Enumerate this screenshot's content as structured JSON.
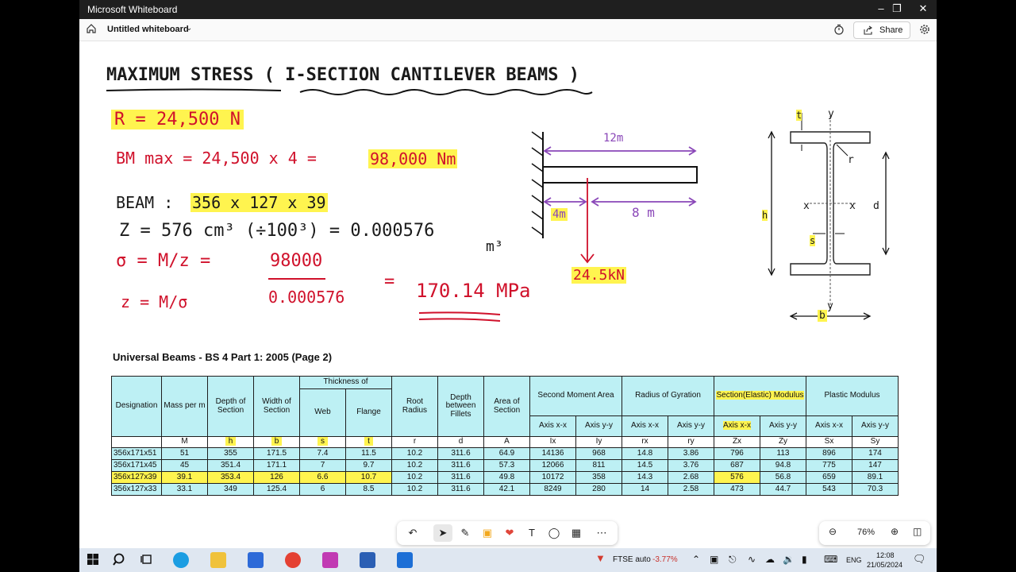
{
  "window": {
    "title": "Microsoft Whiteboard"
  },
  "header": {
    "board_title": "Untitled whiteboard",
    "share_label": "Share"
  },
  "notes": {
    "title": "MAXIMUM STRESS ( I-SECTION CANTILEVER BEAMS )",
    "r_line": "R = 24,500 N",
    "bm_line_a": "BM max = 24,500 x 4 =",
    "bm_line_b": "98,000 Nm",
    "beam_label": "BEAM :",
    "beam_value": "356 x 127 x 39",
    "z_line": "Z = 576 cm³ (÷100³) = 0.000576",
    "z_unit": "m³",
    "sigma_line": "σ = M/z =",
    "fraction_num": "98000",
    "fraction_den": "0.000576",
    "equals": "=",
    "result": "170.14 MPa",
    "z_formula": "z = M/σ"
  },
  "beam_diagram": {
    "length_total": "12m",
    "dist_a": "4m",
    "dist_b": "8 m",
    "load": "24.5kN"
  },
  "section_diagram": {
    "t": "t",
    "y_top": "y",
    "r": "r",
    "h": "h",
    "x_left": "x",
    "x_right": "x",
    "d": "d",
    "s": "s",
    "y_bottom": "y",
    "b": "b"
  },
  "table": {
    "title": "Universal Beams - BS 4 Part 1: 2005 (Page 2)",
    "headers": {
      "designation": "Designation",
      "mass": "Mass per m",
      "depth": "Depth of Section",
      "width": "Width of Section",
      "thickness": "Thickness of",
      "web": "Web",
      "flange": "Flange",
      "root": "Root Radius",
      "depth_fillets": "Depth between Fillets",
      "area": "Area of Section",
      "second_moment": "Second Moment Area",
      "gyration": "Radius of Gyration",
      "elastic": "Section(Elastic) Modulus",
      "plastic": "Plastic Modulus",
      "axis_xx": "Axis x-x",
      "axis_yy": "Axis y-y"
    },
    "symbols": [
      "",
      "M",
      "h",
      "b",
      "s",
      "t",
      "r",
      "d",
      "A",
      "Ix",
      "Iy",
      "rx",
      "ry",
      "Zx",
      "Zy",
      "Sx",
      "Sy"
    ],
    "rows": [
      [
        "356x171x51",
        "51",
        "355",
        "171.5",
        "7.4",
        "11.5",
        "10.2",
        "311.6",
        "64.9",
        "14136",
        "968",
        "14.8",
        "3.86",
        "796",
        "113",
        "896",
        "174"
      ],
      [
        "356x171x45",
        "45",
        "351.4",
        "171.1",
        "7",
        "9.7",
        "10.2",
        "311.6",
        "57.3",
        "12066",
        "811",
        "14.5",
        "3.76",
        "687",
        "94.8",
        "775",
        "147"
      ],
      [
        "356x127x39",
        "39.1",
        "353.4",
        "126",
        "6.6",
        "10.7",
        "10.2",
        "311.6",
        "49.8",
        "10172",
        "358",
        "14.3",
        "2.68",
        "576",
        "56.8",
        "659",
        "89.1"
      ],
      [
        "356x127x33",
        "33.1",
        "349",
        "125.4",
        "6",
        "8.5",
        "10.2",
        "311.6",
        "42.1",
        "8249",
        "280",
        "14",
        "2.58",
        "473",
        "44.7",
        "543",
        "70.3"
      ]
    ]
  },
  "zoom": {
    "level": "76%"
  },
  "taskbar": {
    "ticker_name": "FTSE auto",
    "ticker_change": "-3.77%",
    "lang": "ENG",
    "time": "12:08",
    "date": "21/05/2024"
  }
}
